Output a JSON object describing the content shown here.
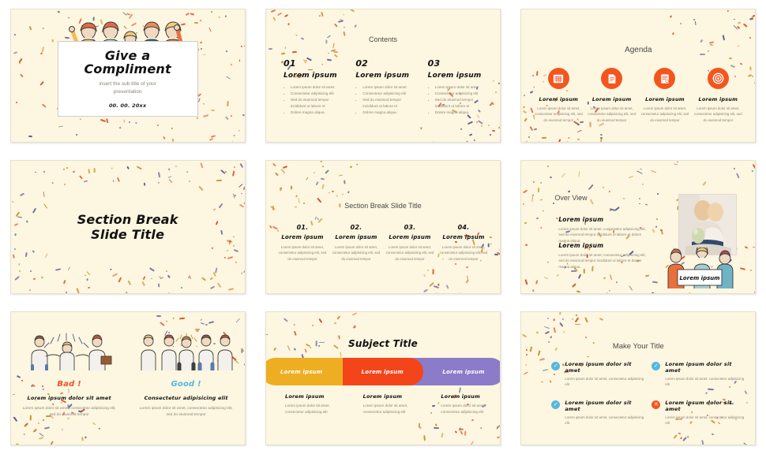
{
  "theme": {
    "background": "#fdf6e0",
    "accent_orange": "#f4551d",
    "accent_yellow": "#eeae22",
    "accent_purple": "#8b7bc9",
    "accent_blue": "#57b7de",
    "text_dark": "#111111",
    "text_muted": "#8a8478",
    "confetti_orange": "#d9502a",
    "confetti_blue": "#5a5f8f",
    "confetti_tan": "#c9922f"
  },
  "slides": [
    {
      "id": "title-slide",
      "title_line1": "Give a",
      "title_line2": "Compliment",
      "subtitle": "insert the sub title of your presentation",
      "date": "00. 00. 20xx"
    },
    {
      "id": "contents-slide",
      "heading": "Contents",
      "columns": [
        {
          "number": "01",
          "subtitle": "Lorem ipsum",
          "bullets": [
            "Lorem ipsum dolor sit amet",
            "Consectetur adipisicing elit",
            "Sed do eiusmod tempor incididunt ut labore et",
            "Dolore magna aliqua."
          ]
        },
        {
          "number": "02",
          "subtitle": "Lorem ipsum",
          "bullets": [
            "Lorem ipsum dolor sit amet",
            "Consectetur adipisicing elit",
            "Sed do eiusmod tempor incididunt ut labore et",
            "Dolore magna aliqua."
          ]
        },
        {
          "number": "03",
          "subtitle": "Lorem ipsum",
          "bullets": [
            "Lorem ipsum dolor sit amet",
            "Consectetur adipisicing elit",
            "Sed do eiusmod tempor incididunt ut labore et",
            "Dolore magna aliqua."
          ]
        }
      ]
    },
    {
      "id": "agenda-slide",
      "heading": "Agenda",
      "items": [
        {
          "icon": "calendar-icon",
          "title": "Lorem ipsum",
          "desc": "Lorem ipsum dolor sit amet, consectetur adipisicing elit, sed do eiusmod tempor"
        },
        {
          "icon": "document-icon",
          "title": "Lorem ipsum",
          "desc": "Lorem ipsum dolor sit amet, consectetur adipisicing elit, sed do eiusmod tempor"
        },
        {
          "icon": "checklist-icon",
          "title": "Lorem ipsum",
          "desc": "Lorem ipsum dolor sit amet, consectetur adipisicing elit, sed do eiusmod tempor"
        },
        {
          "icon": "target-icon",
          "title": "Lorem ipsum",
          "desc": "Lorem ipsum dolor sit amet, consectetur adipisicing elit, sed do eiusmod tempor"
        }
      ]
    },
    {
      "id": "section-break-slide",
      "title_line1": "Section Break",
      "title_line2": "Slide Title"
    },
    {
      "id": "section-break-detail-slide",
      "heading": "Section Break Slide Title",
      "items": [
        {
          "number": "01.",
          "title": "Lorem ipsum",
          "desc": "Lorem ipsum dolor sit amet, consectetur adipisicing elit, sed do eiusmod tempor"
        },
        {
          "number": "02.",
          "title": "Lorem ipsum",
          "desc": "Lorem ipsum dolor sit amet, consectetur adipisicing elit, sed do eiusmod tempor"
        },
        {
          "number": "03.",
          "title": "Lorem ipsum",
          "desc": "Lorem ipsum dolor sit amet, consectetur adipisicing elit, sed do eiusmod tempor"
        },
        {
          "number": "04.",
          "title": "Lorem ipsum",
          "desc": "Lorem ipsum dolor sit amet, consectetur adipisicing elit, sed do eiusmod tempor"
        }
      ]
    },
    {
      "id": "overview-slide",
      "heading": "Over View",
      "blocks": [
        {
          "title": "Lorem ipsum",
          "desc": "Lorem ipsum dolor sit amet, consectetur adipisicing elit, sed do eiusmod tempor incididunt ut labore et dolore magna aliqua."
        },
        {
          "title": "Lorem ipsum",
          "desc": "Lorem ipsum dolor sit amet, consectetur adipisicing elit, sed do eiusmod tempor incididunt ut labore et dolore magna aliqua."
        }
      ],
      "banner_text": "Lorem ipsum"
    },
    {
      "id": "bad-good-slide",
      "left": {
        "badge": "Bad !",
        "badge_color": "#f0532a",
        "subtitle": "Lorem ipsum dolor sit amet",
        "desc": "Lorem ipsum dolor sit amet, consectetur adipisicing elit, sed do eiusmod tempor"
      },
      "right": {
        "badge": "Good !",
        "badge_color": "#4db8e8",
        "subtitle": "Consectetur adipisicing elit",
        "desc": "Lorem ipsum dolor sit amet, consectetur adipisicing elit, sed do eiusmod tempor"
      }
    },
    {
      "id": "subject-title-slide",
      "heading": "Subject Title",
      "bars": [
        {
          "label": "Lorem ipsum",
          "color": "#eeae22"
        },
        {
          "label": "Lorem ipsum",
          "color": "#f4451a"
        },
        {
          "label": "Lorem ipsum",
          "color": "#8b7bc9"
        }
      ],
      "columns": [
        {
          "title": "Lorem ipsum",
          "desc": "Lorem ipsum dolor sit amet, consectetur adipisicing elit"
        },
        {
          "title": "Lorem ipsum",
          "desc": "Lorem ipsum dolor sit amet, consectetur adipisicing elit"
        },
        {
          "title": "Lorem ipsum",
          "desc": "Lorem ipsum dolor sit amet, consectetur adipisicing elit"
        }
      ]
    },
    {
      "id": "make-your-title-slide",
      "heading": "Make Your Title",
      "items": [
        {
          "icon": "check-circle-icon",
          "state": "ok",
          "glyph": "✓",
          "title": "Lorem ipsum dolor sit amet",
          "desc": "Lorem ipsum dolor sit amet, consectetur adipisicing elit"
        },
        {
          "icon": "check-circle-icon",
          "state": "ok",
          "glyph": "✓",
          "title": "Lorem ipsum dolor sit amet",
          "desc": "Lorem ipsum dolor sit amet, consectetur adipisicing elit"
        },
        {
          "icon": "check-circle-icon",
          "state": "ok",
          "glyph": "✓",
          "title": "Lorem ipsum dolor sit amet",
          "desc": "Lorem ipsum dolor sit amet, consectetur adipisicing elit"
        },
        {
          "icon": "close-circle-icon",
          "state": "no",
          "glyph": "✕",
          "title": "Lorem ipsum dolor sit amet",
          "desc": "Lorem ipsum dolor sit amet, consectetur adipisicing elit"
        }
      ]
    }
  ]
}
